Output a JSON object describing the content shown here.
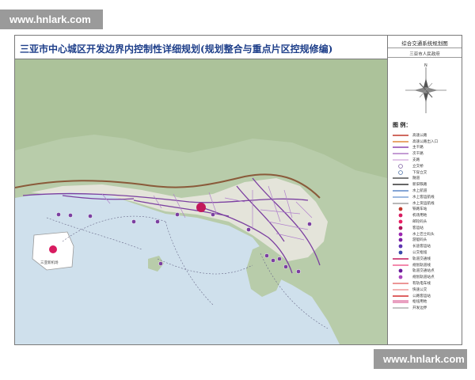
{
  "watermark": {
    "top": "www.hnlark.com",
    "bottom": "www.hnlark.com"
  },
  "title": "三亚市中心城区开发边界内控制性详细规划(规划整合与重点片区控规修编)",
  "legend_panel": {
    "heading": "综合交通系统规划图",
    "subheading": "三亚市人民政府",
    "legend_title": "图 例：",
    "items": [
      {
        "label": "高速公路",
        "symbol": "line",
        "color": "#c0392b"
      },
      {
        "label": "高速公路出入口",
        "symbol": "line",
        "color": "#e08a3c"
      },
      {
        "label": "主干路",
        "symbol": "line",
        "color": "#8e44ad"
      },
      {
        "label": "次干路",
        "symbol": "line",
        "color": "#b07cc6"
      },
      {
        "label": "支路",
        "symbol": "line",
        "color": "#d9b3e0"
      },
      {
        "label": "立交桥",
        "symbol": "circle",
        "color": "#7d5fa0"
      },
      {
        "label": "下穿立交",
        "symbol": "circle",
        "color": "#4a6fa5"
      },
      {
        "label": "隧道",
        "symbol": "line",
        "color": "#555555"
      },
      {
        "label": "新旧铁路",
        "symbol": "line",
        "color": "#333333"
      },
      {
        "label": "水上航道",
        "symbol": "line",
        "color": "#5b87c7"
      },
      {
        "label": "水上客运航线",
        "symbol": "line",
        "color": "#7fa3d6"
      },
      {
        "label": "水上货运航线",
        "symbol": "line",
        "color": "#a0a0a0"
      },
      {
        "label": "铁路车站",
        "symbol": "dot",
        "color": "#c0392b"
      },
      {
        "label": "机场用地",
        "symbol": "dot",
        "color": "#d81b60"
      },
      {
        "label": "邮轮码头",
        "symbol": "dot",
        "color": "#e91e63"
      },
      {
        "label": "客运站",
        "symbol": "dot",
        "color": "#ad1457"
      },
      {
        "label": "水上巴士码头",
        "symbol": "dot",
        "color": "#9c27b0"
      },
      {
        "label": "游艇码头",
        "symbol": "dot",
        "color": "#7b1fa2"
      },
      {
        "label": "长途客运站",
        "symbol": "dot",
        "color": "#5e35b1"
      },
      {
        "label": "公交枢纽",
        "symbol": "dot",
        "color": "#3949ab"
      },
      {
        "label": "轨道交通线",
        "symbol": "line",
        "color": "#c2185b"
      },
      {
        "label": "规划轨道线",
        "symbol": "line",
        "color": "#f06292"
      },
      {
        "label": "轨道交通站点",
        "symbol": "dot",
        "color": "#6a1b9a"
      },
      {
        "label": "规划轨道站点",
        "symbol": "dot",
        "color": "#ab47bc"
      },
      {
        "label": "有轨电车线",
        "symbol": "line",
        "color": "#e57373"
      },
      {
        "label": "快速公交",
        "symbol": "line",
        "color": "#ef9a9a"
      },
      {
        "label": "公路客运站",
        "symbol": "line",
        "color": "#d32f2f"
      },
      {
        "label": "枢纽用地",
        "symbol": "band",
        "color": "#e9a0c0"
      },
      {
        "label": "开发边界",
        "symbol": "line",
        "color": "#b0b0b0"
      }
    ]
  },
  "map": {
    "colors": {
      "sea": "#cfe0ec",
      "land": "#b8ccaa",
      "hills": "#a9bf98",
      "urban": "#e9e7df",
      "boundary": "#8a5a3a",
      "main_road": "#7b3fa0",
      "secondary_road": "#b080cc",
      "ferry_route": "#6a6a8a",
      "hub": "#c2185b",
      "airport": "#d81b60",
      "marker": "#7b3fa0"
    },
    "airport_label": "三亚新机场"
  }
}
